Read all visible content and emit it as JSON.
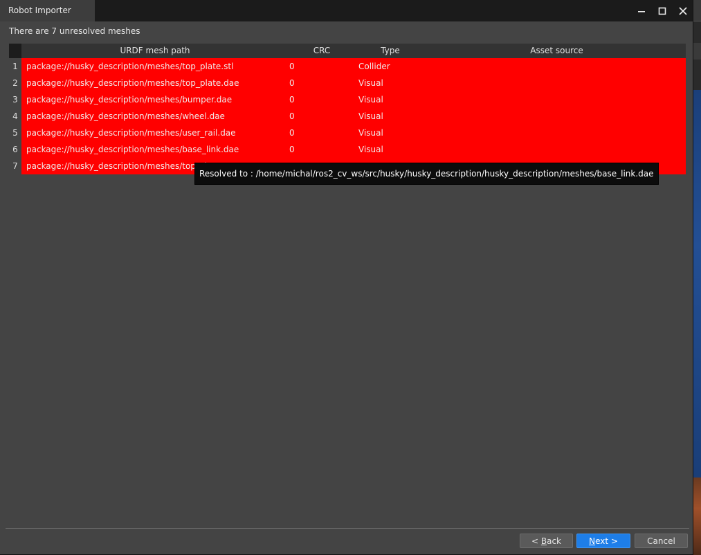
{
  "window": {
    "title": "Robot Importer"
  },
  "summary": "There are 7 unresolved meshes",
  "table": {
    "headers": {
      "path": "URDF mesh path",
      "crc": "CRC",
      "type": "Type",
      "source": "Asset source"
    },
    "rows": [
      {
        "num": "1",
        "path": "package://husky_description/meshes/top_plate.stl",
        "crc": "0",
        "type": "Collider",
        "source": ""
      },
      {
        "num": "2",
        "path": "package://husky_description/meshes/top_plate.dae",
        "crc": "0",
        "type": "Visual",
        "source": ""
      },
      {
        "num": "3",
        "path": "package://husky_description/meshes/bumper.dae",
        "crc": "0",
        "type": "Visual",
        "source": ""
      },
      {
        "num": "4",
        "path": "package://husky_description/meshes/wheel.dae",
        "crc": "0",
        "type": "Visual",
        "source": ""
      },
      {
        "num": "5",
        "path": "package://husky_description/meshes/user_rail.dae",
        "crc": "0",
        "type": "Visual",
        "source": ""
      },
      {
        "num": "6",
        "path": "package://husky_description/meshes/base_link.dae",
        "crc": "0",
        "type": "Visual",
        "source": ""
      },
      {
        "num": "7",
        "path": "package://husky_description/meshes/top_ch",
        "crc": "",
        "type": "",
        "source": ""
      }
    ],
    "row_color": "#ff0000"
  },
  "tooltip": "Resolved to : /home/michal/ros2_cv_ws/src/husky/husky_description/husky_description/meshes/base_link.dae",
  "buttons": {
    "back_prefix": "< ",
    "back_key": "B",
    "back_rest": "ack",
    "next_key": "N",
    "next_rest": "ext >",
    "cancel": "Cancel"
  },
  "colors": {
    "accent": "#1e7ee8",
    "error_row": "#ff0000",
    "background": "#444444"
  }
}
